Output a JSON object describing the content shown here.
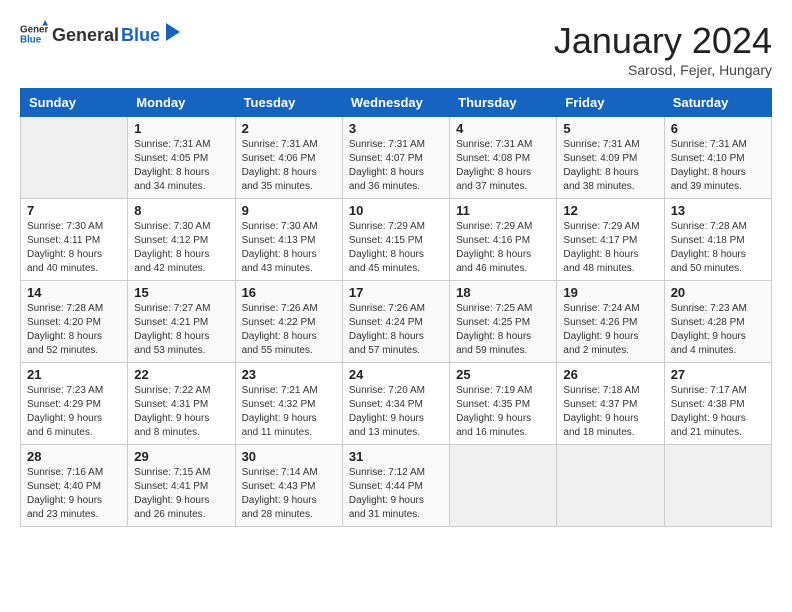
{
  "header": {
    "logo_general": "General",
    "logo_blue": "Blue",
    "title": "January 2024",
    "location": "Sarosd, Fejer, Hungary"
  },
  "days_of_week": [
    "Sunday",
    "Monday",
    "Tuesday",
    "Wednesday",
    "Thursday",
    "Friday",
    "Saturday"
  ],
  "weeks": [
    [
      {
        "day": "",
        "sunrise": "",
        "sunset": "",
        "daylight": ""
      },
      {
        "day": "1",
        "sunrise": "7:31 AM",
        "sunset": "4:05 PM",
        "daylight": "8 hours and 34 minutes."
      },
      {
        "day": "2",
        "sunrise": "7:31 AM",
        "sunset": "4:06 PM",
        "daylight": "8 hours and 35 minutes."
      },
      {
        "day": "3",
        "sunrise": "7:31 AM",
        "sunset": "4:07 PM",
        "daylight": "8 hours and 36 minutes."
      },
      {
        "day": "4",
        "sunrise": "7:31 AM",
        "sunset": "4:08 PM",
        "daylight": "8 hours and 37 minutes."
      },
      {
        "day": "5",
        "sunrise": "7:31 AM",
        "sunset": "4:09 PM",
        "daylight": "8 hours and 38 minutes."
      },
      {
        "day": "6",
        "sunrise": "7:31 AM",
        "sunset": "4:10 PM",
        "daylight": "8 hours and 39 minutes."
      }
    ],
    [
      {
        "day": "7",
        "sunrise": "7:30 AM",
        "sunset": "4:11 PM",
        "daylight": "8 hours and 40 minutes."
      },
      {
        "day": "8",
        "sunrise": "7:30 AM",
        "sunset": "4:12 PM",
        "daylight": "8 hours and 42 minutes."
      },
      {
        "day": "9",
        "sunrise": "7:30 AM",
        "sunset": "4:13 PM",
        "daylight": "8 hours and 43 minutes."
      },
      {
        "day": "10",
        "sunrise": "7:29 AM",
        "sunset": "4:15 PM",
        "daylight": "8 hours and 45 minutes."
      },
      {
        "day": "11",
        "sunrise": "7:29 AM",
        "sunset": "4:16 PM",
        "daylight": "8 hours and 46 minutes."
      },
      {
        "day": "12",
        "sunrise": "7:29 AM",
        "sunset": "4:17 PM",
        "daylight": "8 hours and 48 minutes."
      },
      {
        "day": "13",
        "sunrise": "7:28 AM",
        "sunset": "4:18 PM",
        "daylight": "8 hours and 50 minutes."
      }
    ],
    [
      {
        "day": "14",
        "sunrise": "7:28 AM",
        "sunset": "4:20 PM",
        "daylight": "8 hours and 52 minutes."
      },
      {
        "day": "15",
        "sunrise": "7:27 AM",
        "sunset": "4:21 PM",
        "daylight": "8 hours and 53 minutes."
      },
      {
        "day": "16",
        "sunrise": "7:26 AM",
        "sunset": "4:22 PM",
        "daylight": "8 hours and 55 minutes."
      },
      {
        "day": "17",
        "sunrise": "7:26 AM",
        "sunset": "4:24 PM",
        "daylight": "8 hours and 57 minutes."
      },
      {
        "day": "18",
        "sunrise": "7:25 AM",
        "sunset": "4:25 PM",
        "daylight": "8 hours and 59 minutes."
      },
      {
        "day": "19",
        "sunrise": "7:24 AM",
        "sunset": "4:26 PM",
        "daylight": "9 hours and 2 minutes."
      },
      {
        "day": "20",
        "sunrise": "7:23 AM",
        "sunset": "4:28 PM",
        "daylight": "9 hours and 4 minutes."
      }
    ],
    [
      {
        "day": "21",
        "sunrise": "7:23 AM",
        "sunset": "4:29 PM",
        "daylight": "9 hours and 6 minutes."
      },
      {
        "day": "22",
        "sunrise": "7:22 AM",
        "sunset": "4:31 PM",
        "daylight": "9 hours and 8 minutes."
      },
      {
        "day": "23",
        "sunrise": "7:21 AM",
        "sunset": "4:32 PM",
        "daylight": "9 hours and 11 minutes."
      },
      {
        "day": "24",
        "sunrise": "7:20 AM",
        "sunset": "4:34 PM",
        "daylight": "9 hours and 13 minutes."
      },
      {
        "day": "25",
        "sunrise": "7:19 AM",
        "sunset": "4:35 PM",
        "daylight": "9 hours and 16 minutes."
      },
      {
        "day": "26",
        "sunrise": "7:18 AM",
        "sunset": "4:37 PM",
        "daylight": "9 hours and 18 minutes."
      },
      {
        "day": "27",
        "sunrise": "7:17 AM",
        "sunset": "4:38 PM",
        "daylight": "9 hours and 21 minutes."
      }
    ],
    [
      {
        "day": "28",
        "sunrise": "7:16 AM",
        "sunset": "4:40 PM",
        "daylight": "9 hours and 23 minutes."
      },
      {
        "day": "29",
        "sunrise": "7:15 AM",
        "sunset": "4:41 PM",
        "daylight": "9 hours and 26 minutes."
      },
      {
        "day": "30",
        "sunrise": "7:14 AM",
        "sunset": "4:43 PM",
        "daylight": "9 hours and 28 minutes."
      },
      {
        "day": "31",
        "sunrise": "7:12 AM",
        "sunset": "4:44 PM",
        "daylight": "9 hours and 31 minutes."
      },
      {
        "day": "",
        "sunrise": "",
        "sunset": "",
        "daylight": ""
      },
      {
        "day": "",
        "sunrise": "",
        "sunset": "",
        "daylight": ""
      },
      {
        "day": "",
        "sunrise": "",
        "sunset": "",
        "daylight": ""
      }
    ]
  ],
  "labels": {
    "sunrise_prefix": "Sunrise: ",
    "sunset_prefix": "Sunset: ",
    "daylight_prefix": "Daylight: "
  }
}
